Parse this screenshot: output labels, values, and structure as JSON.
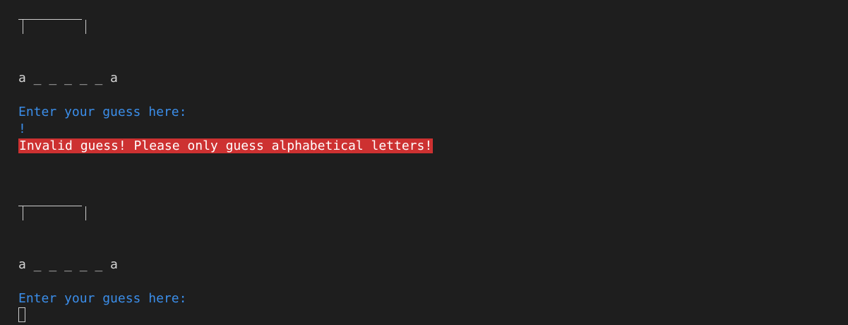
{
  "block1": {
    "word": "a _ _ _ _ _ a",
    "prompt": "Enter your guess here:",
    "input": "!",
    "error": "Invalid guess! Please only guess alphabetical letters!"
  },
  "block2": {
    "word": "a _ _ _ _ _ a",
    "prompt": "Enter your guess here:"
  },
  "colors": {
    "background": "#1e1e1e",
    "prompt": "#3b8eea",
    "error_bg": "#cd3131",
    "text": "#d4d4d4"
  }
}
